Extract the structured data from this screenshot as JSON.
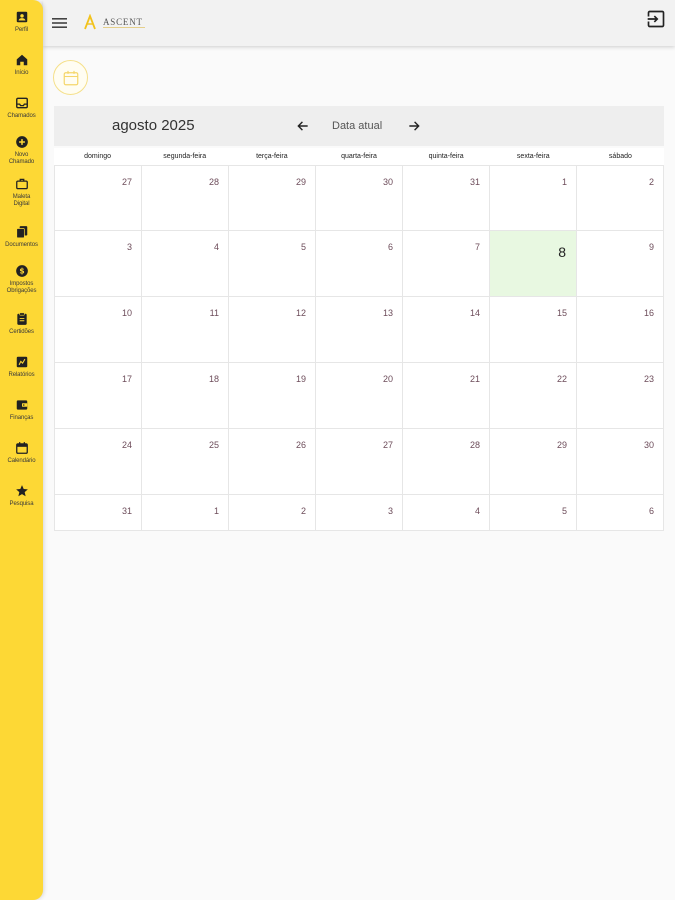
{
  "sidebar": {
    "items": [
      {
        "icon": "profile-icon",
        "label": "Perfil"
      },
      {
        "icon": "home-icon",
        "label": "Início"
      },
      {
        "icon": "inbox-icon",
        "label": "Chamados"
      },
      {
        "icon": "add-circle-icon",
        "label": "Novo\nChamado"
      },
      {
        "icon": "briefcase-icon",
        "label": "Maleta\nDigital"
      },
      {
        "icon": "documents-icon",
        "label": "Documentos"
      },
      {
        "icon": "money-icon",
        "label": "Impostos\nObrigações"
      },
      {
        "icon": "clipboard-icon",
        "label": "Certidões"
      },
      {
        "icon": "report-icon",
        "label": "Relatórios"
      },
      {
        "icon": "wallet-icon",
        "label": "Finanças"
      },
      {
        "icon": "calendar-icon",
        "label": "Calendário"
      },
      {
        "icon": "star-icon",
        "label": "Pesquisa"
      }
    ]
  },
  "header": {
    "logo_text": "ASCENT"
  },
  "calendar": {
    "title": "agosto 2025",
    "today_label": "Data atual",
    "weekdays": [
      "domingo",
      "segunda-feira",
      "terça-feira",
      "quarta-feira",
      "quinta-feira",
      "sexta-feira",
      "sábado"
    ],
    "weeks": [
      [
        "27",
        "28",
        "29",
        "30",
        "31",
        "1",
        "2"
      ],
      [
        "3",
        "4",
        "5",
        "6",
        "7",
        "8",
        "9"
      ],
      [
        "10",
        "11",
        "12",
        "13",
        "14",
        "15",
        "16"
      ],
      [
        "17",
        "18",
        "19",
        "20",
        "21",
        "22",
        "23"
      ],
      [
        "24",
        "25",
        "26",
        "27",
        "28",
        "29",
        "30"
      ],
      [
        "31",
        "1",
        "2",
        "3",
        "4",
        "5",
        "6"
      ]
    ],
    "today": "8"
  },
  "colors": {
    "accent": "#fdd835",
    "today_bg": "#e8f8e1"
  }
}
